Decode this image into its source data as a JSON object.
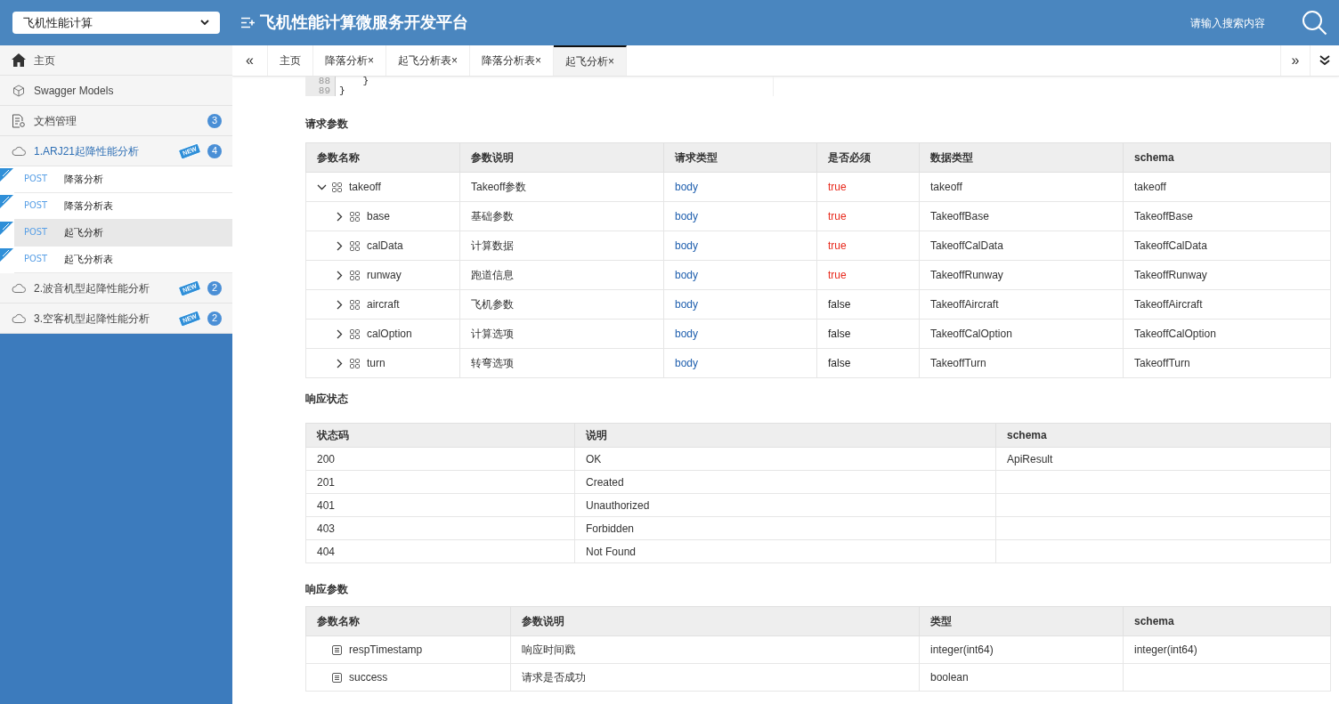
{
  "header": {
    "selector_value": "飞机性能计算",
    "title": "飞机性能计算微服务开发平台",
    "search_placeholder": "请输入搜索内容"
  },
  "sidebar": {
    "items": [
      {
        "kind": "home",
        "label": "主页"
      },
      {
        "kind": "models",
        "label": "Swagger Models"
      },
      {
        "kind": "docs",
        "label": "文档管理",
        "count": "3"
      },
      {
        "kind": "group",
        "label": "1.ARJ21起降性能分析",
        "new_tag": "NEW",
        "count": "4",
        "expanded": true,
        "children": [
          {
            "method": "POST",
            "label": "降落分析",
            "new": true,
            "selected": false
          },
          {
            "method": "POST",
            "label": "降落分析表",
            "new": true,
            "selected": false
          },
          {
            "method": "POST",
            "label": "起飞分析",
            "new": true,
            "selected": true
          },
          {
            "method": "POST",
            "label": "起飞分析表",
            "new": true,
            "selected": false
          }
        ]
      },
      {
        "kind": "group",
        "label": "2.波音机型起降性能分析",
        "new_tag": "NEW",
        "count": "2",
        "expanded": false
      },
      {
        "kind": "group",
        "label": "3.空客机型起降性能分析",
        "new_tag": "NEW",
        "count": "2",
        "expanded": false
      }
    ]
  },
  "tabs": {
    "prev": "«",
    "next": "»",
    "items": [
      {
        "label": "主页",
        "selected": false
      },
      {
        "label": "降落分析",
        "close": "×",
        "selected": false
      },
      {
        "label": "起飞分析表",
        "close": "×",
        "selected": false
      },
      {
        "label": "降落分析表",
        "close": "×",
        "selected": false
      },
      {
        "label": "起飞分析",
        "close": "×",
        "selected": true
      }
    ]
  },
  "code": {
    "lines": [
      {
        "number": "88",
        "text": "    }"
      },
      {
        "number": "89",
        "text": "}"
      }
    ]
  },
  "request_params": {
    "heading": "请求参数",
    "columns": [
      "参数名称",
      "参数说明",
      "请求类型",
      "是否必须",
      "数据类型",
      "schema"
    ],
    "rows": [
      {
        "name": "takeoff",
        "description": "Takeoff参数",
        "in": "body",
        "required": "true",
        "required_flag": true,
        "type": "takeoff",
        "schema": "takeoff",
        "expanded": true,
        "children": [
          {
            "name": "base",
            "description": "基础参数",
            "in": "body",
            "required": "true",
            "required_flag": true,
            "type": "TakeoffBase",
            "schema": "TakeoffBase",
            "expanded": false
          },
          {
            "name": "calData",
            "description": "计算数据",
            "in": "body",
            "required": "true",
            "required_flag": true,
            "type": "TakeoffCalData",
            "schema": "TakeoffCalData",
            "expanded": false
          },
          {
            "name": "runway",
            "description": "跑道信息",
            "in": "body",
            "required": "true",
            "required_flag": true,
            "type": "TakeoffRunway",
            "schema": "TakeoffRunway",
            "expanded": false
          },
          {
            "name": "aircraft",
            "description": "飞机参数",
            "in": "body",
            "required": "false",
            "required_flag": false,
            "type": "TakeoffAircraft",
            "schema": "TakeoffAircraft",
            "expanded": false
          },
          {
            "name": "calOption",
            "description": "计算选项",
            "in": "body",
            "required": "false",
            "required_flag": false,
            "type": "TakeoffCalOption",
            "schema": "TakeoffCalOption",
            "expanded": false
          },
          {
            "name": "turn",
            "description": "转弯选项",
            "in": "body",
            "required": "false",
            "required_flag": false,
            "type": "TakeoffTurn",
            "schema": "TakeoffTurn",
            "expanded": false
          }
        ]
      }
    ]
  },
  "response_status": {
    "heading": "响应状态",
    "columns": [
      "状态码",
      "说明",
      "schema"
    ],
    "rows": [
      [
        "200",
        "OK",
        "ApiResult"
      ],
      [
        "201",
        "Created",
        ""
      ],
      [
        "401",
        "Unauthorized",
        ""
      ],
      [
        "403",
        "Forbidden",
        ""
      ],
      [
        "404",
        "Not Found",
        ""
      ]
    ]
  },
  "response_params": {
    "heading": "响应参数",
    "columns": [
      "参数名称",
      "参数说明",
      "类型",
      "schema"
    ],
    "rows": [
      [
        "respTimestamp",
        "响应时间戳",
        "integer(int64)",
        "integer(int64)"
      ],
      [
        "success",
        "请求是否成功",
        "boolean",
        ""
      ]
    ]
  }
}
